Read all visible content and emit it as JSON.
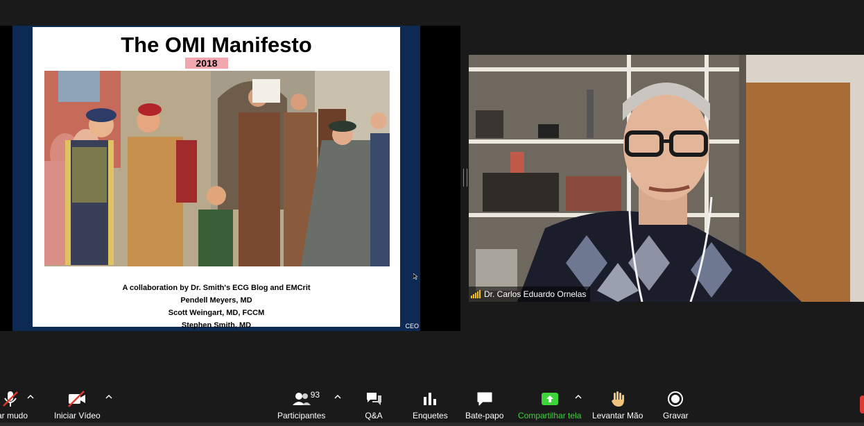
{
  "slide": {
    "title": "The OMI Manifesto",
    "year": "2018",
    "credits": [
      "A collaboration by Dr. Smith's ECG Blog and EMCrit",
      "Pendell Meyers, MD",
      "Scott Weingart, MD, FCCM",
      "Stephen Smith, MD"
    ],
    "corner_text": "CEO"
  },
  "video": {
    "participant_name": "Dr. Carlos Eduardo Ornelas"
  },
  "toolbar": {
    "mute_label": "var mudo",
    "video_label": "Iniciar Vídeo",
    "participants_label": "Participantes",
    "participants_count": "93",
    "qa_label": "Q&A",
    "polls_label": "Enquetes",
    "chat_label": "Bate-papo",
    "share_label": "Compartilhar tela",
    "raise_hand_label": "Levantar Mão",
    "record_label": "Gravar"
  },
  "colors": {
    "background": "#1a1a1a",
    "slide_frame": "#0d2a55",
    "year_highlight": "#f2a6ad",
    "share_green": "#3ed43b",
    "signal_yellow": "#f5c21b",
    "video_off_red": "#e0382e"
  },
  "icons": {
    "mute": "microphone-muted-icon",
    "video": "video-camera-off-icon",
    "participants": "people-icon",
    "qa": "chat-bubbles-icon",
    "polls": "bar-chart-icon",
    "chat": "speech-bubble-icon",
    "share": "share-screen-arrow-icon",
    "raise_hand": "hand-icon",
    "record": "record-circle-icon"
  }
}
